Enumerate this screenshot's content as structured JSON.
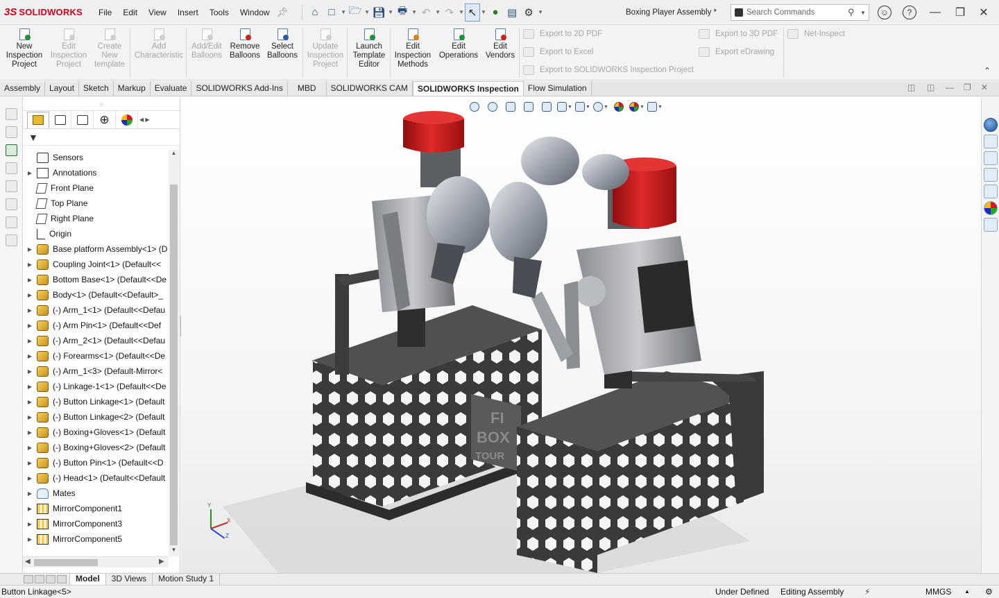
{
  "app": {
    "logo_ds": "3S",
    "logo_text": "SOLIDWORKS",
    "document_title": "Boxing Player Assembly *"
  },
  "menu": [
    "File",
    "Edit",
    "View",
    "Insert",
    "Tools",
    "Window"
  ],
  "search": {
    "placeholder": "Search Commands"
  },
  "ribbon": {
    "buttons": [
      {
        "label_1": "New",
        "label_2": "Inspection",
        "label_3": "Project",
        "enabled": true
      },
      {
        "label_1": "Edit",
        "label_2": "Inspection",
        "label_3": "Project",
        "enabled": false
      },
      {
        "label_1": "Create",
        "label_2": "New",
        "label_3": "template",
        "enabled": false
      },
      {
        "label_1": "Add",
        "label_2": "Characteristic",
        "label_3": "",
        "enabled": false
      },
      {
        "label_1": "Add/Edit",
        "label_2": "Balloons",
        "label_3": "",
        "enabled": false
      },
      {
        "label_1": "Remove",
        "label_2": "Balloons",
        "label_3": "",
        "enabled": true
      },
      {
        "label_1": "Select",
        "label_2": "Balloons",
        "label_3": "",
        "enabled": true
      },
      {
        "label_1": "Update",
        "label_2": "Inspection",
        "label_3": "Project",
        "enabled": false
      },
      {
        "label_1": "Launch",
        "label_2": "Template",
        "label_3": "Editor",
        "enabled": true
      },
      {
        "label_1": "Edit",
        "label_2": "Inspection",
        "label_3": "Methods",
        "enabled": true
      },
      {
        "label_1": "Edit",
        "label_2": "Operations",
        "label_3": "",
        "enabled": true
      },
      {
        "label_1": "Edit",
        "label_2": "Vendors",
        "label_3": "",
        "enabled": true
      }
    ],
    "exports": {
      "pdf2d": "Export to 2D PDF",
      "excel": "Export to Excel",
      "sw_project": "Export to SOLIDWORKS Inspection Project",
      "pdf3d": "Export to 3D PDF",
      "edrawing": "Export eDrawing",
      "net_inspect": "Net-Inspect"
    }
  },
  "tabs": [
    "Assembly",
    "Layout",
    "Sketch",
    "Markup",
    "Evaluate",
    "SOLIDWORKS Add-Ins",
    "MBD",
    "SOLIDWORKS CAM",
    "SOLIDWORKS Inspection",
    "Flow Simulation"
  ],
  "active_tab": "SOLIDWORKS Inspection",
  "tree": [
    {
      "label": "Sensors",
      "icon": "sensor",
      "expandable": false
    },
    {
      "label": "Annotations",
      "icon": "annot",
      "expandable": true
    },
    {
      "label": "Front Plane",
      "icon": "plane",
      "expandable": false
    },
    {
      "label": "Top Plane",
      "icon": "plane",
      "expandable": false
    },
    {
      "label": "Right Plane",
      "icon": "plane",
      "expandable": false
    },
    {
      "label": "Origin",
      "icon": "origin",
      "expandable": false
    },
    {
      "label": "Base platform Assembly<1> (D",
      "icon": "part",
      "expandable": true
    },
    {
      "label": "Coupling Joint<1> (Default<<",
      "icon": "part",
      "expandable": true
    },
    {
      "label": "Bottom Base<1> (Default<<De",
      "icon": "part",
      "expandable": true
    },
    {
      "label": "Body<1> (Default<<Default>_",
      "icon": "part",
      "expandable": true
    },
    {
      "label": "(-) Arm_1<1> (Default<<Defau",
      "icon": "part",
      "expandable": true
    },
    {
      "label": "(-) Arm Pin<1> (Default<<Def",
      "icon": "part",
      "expandable": true
    },
    {
      "label": "(-) Arm_2<1> (Default<<Defau",
      "icon": "part",
      "expandable": true
    },
    {
      "label": "(-) Forearms<1> (Default<<De",
      "icon": "part",
      "expandable": true
    },
    {
      "label": "(-) Arm_1<3> (Default-Mirror<",
      "icon": "part",
      "expandable": true
    },
    {
      "label": "(-) Linkage-1<1> (Default<<De",
      "icon": "part",
      "expandable": true
    },
    {
      "label": "(-) Button Linkage<1> (Default",
      "icon": "part",
      "expandable": true
    },
    {
      "label": "(-) Button Linkage<2> (Default",
      "icon": "part",
      "expandable": true
    },
    {
      "label": "(-) Boxing+Gloves<1> (Default",
      "icon": "part",
      "expandable": true
    },
    {
      "label": "(-) Boxing+Gloves<2> (Default",
      "icon": "part",
      "expandable": true
    },
    {
      "label": "(-) Button Pin<1> (Default<<D",
      "icon": "part",
      "expandable": true
    },
    {
      "label": "(-) Head<1> (Default<<Default",
      "icon": "part",
      "expandable": true
    },
    {
      "label": "Mates",
      "icon": "mates",
      "expandable": true
    },
    {
      "label": "MirrorComponent1",
      "icon": "mirror",
      "expandable": true
    },
    {
      "label": "MirrorComponent3",
      "icon": "mirror",
      "expandable": true
    },
    {
      "label": "MirrorComponent5",
      "icon": "mirror",
      "expandable": true
    }
  ],
  "model": {
    "sign_text_1": "FI",
    "sign_text_2": "BOX",
    "sign_text_3": "TOUR"
  },
  "triad": {
    "x": "X",
    "y": "Y",
    "z": "Z"
  },
  "bottom_tabs": [
    "Model",
    "3D Views",
    "Motion Study 1"
  ],
  "active_bottom_tab": "Model",
  "status": {
    "selection": "Button Linkage<5>",
    "definition": "Under Defined",
    "mode": "Editing Assembly",
    "units": "MMGS"
  },
  "colors": {
    "brand_red": "#d0021b",
    "head_red": "#d21d1d",
    "glove_gray": "#9ea4ad",
    "base_dark": "#3b3b3b"
  }
}
